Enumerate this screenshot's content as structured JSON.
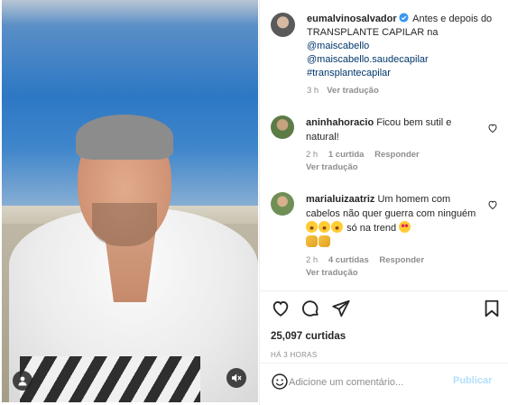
{
  "post": {
    "author": "eumalvinosalvador",
    "caption_text": "Antes e depois do TRANSPLANTE CAPILAR na",
    "mentions": [
      "@maiscabello",
      "@maiscabello.saudecapilar",
      "#transplantecapilar"
    ],
    "time": "3 h",
    "translate": "Ver tradução"
  },
  "comments": [
    {
      "user": "aninhahoracio",
      "text": "Ficou bem sutil e natural!",
      "time": "2 h",
      "likes": "1 curtida",
      "reply": "Responder",
      "translate": "Ver tradução"
    },
    {
      "user": "marialuizaatriz",
      "text": "Um homem com cabelos não quer guerra com ninguém",
      "text_after": "só na trend",
      "time": "2 h",
      "likes": "4 curtidas",
      "reply": "Responder",
      "translate": "Ver tradução"
    }
  ],
  "stats": {
    "likes": "25,097 curtidas",
    "ago": "HÁ 3 HORAS"
  },
  "composer": {
    "placeholder": "Adicione um comentário...",
    "publish": "Publicar"
  },
  "icons": {
    "verified": "verified-badge-icon",
    "heart": "heart-icon",
    "comment": "comment-icon",
    "share": "paper-plane-icon",
    "save": "bookmark-icon",
    "smile": "smiley-icon",
    "user_tag": "user-tag-icon",
    "mute": "speaker-muted-icon"
  },
  "colors": {
    "link": "#00376b",
    "verified": "#3897f0",
    "muted_text": "#8e8e8e",
    "publish_disabled": "#b2dffc"
  }
}
